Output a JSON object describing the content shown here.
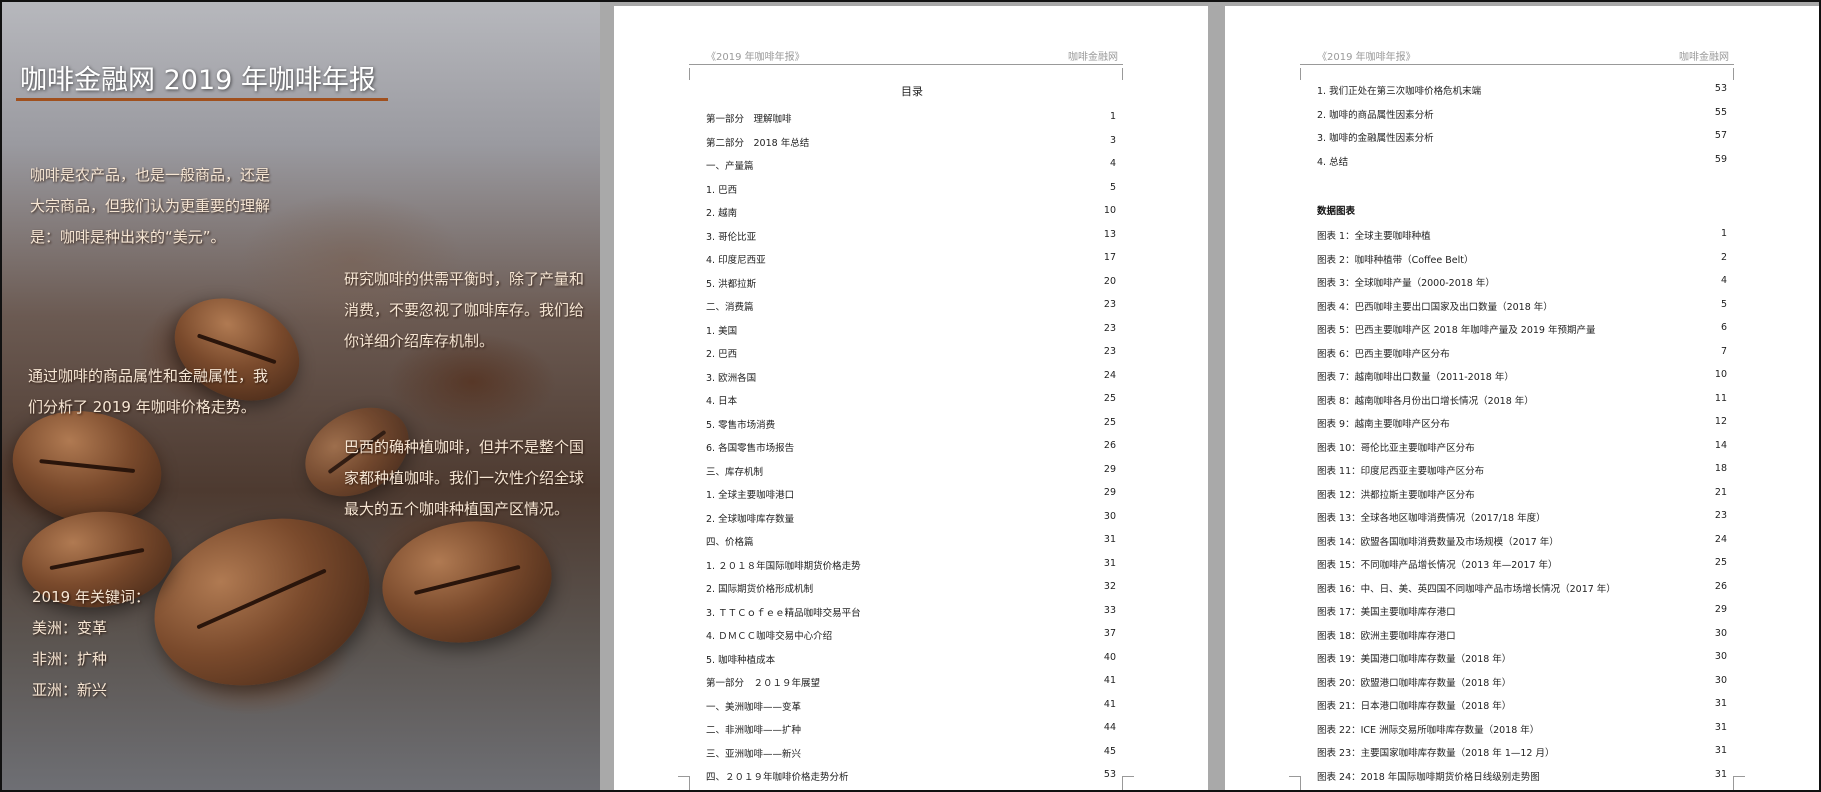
{
  "cover": {
    "title": "咖啡金融网 2019 年咖啡年报",
    "para1": "咖啡是农产品，也是一般商品，还是大宗商品，但我们认为更重要的理解是：咖啡是种出来的“美元”。",
    "para2": "研究咖啡的供需平衡时，除了产量和消费，不要忽视了咖啡库存。我们给你详细介绍库存机制。",
    "para3": "通过咖啡的商品属性和金融属性，我们分析了 2019 年咖啡价格走势。",
    "para4": "巴西的确种植咖啡，但并不是整个国家都种植咖啡。我们一次性介绍全球最大的五个咖啡种植国产区情况。",
    "keywords_title": "2019 年关键词：",
    "keywords": [
      "美洲：变革",
      "非洲：扩种",
      "亚洲：新兴"
    ]
  },
  "page1": {
    "header_left": "《2019 年咖啡年报》",
    "header_right": "咖啡金融网",
    "toc_title": "目录",
    "entries": [
      {
        "text": "第一部分　理解咖啡",
        "page": "1"
      },
      {
        "text": "第二部分　2018 年总结",
        "page": "3"
      },
      {
        "text": "一、产量篇",
        "page": "4"
      },
      {
        "text": "1. 巴西",
        "page": "5"
      },
      {
        "text": "2. 越南",
        "page": "10"
      },
      {
        "text": "3. 哥伦比亚",
        "page": "13"
      },
      {
        "text": "4. 印度尼西亚",
        "page": "17"
      },
      {
        "text": "5. 洪都拉斯",
        "page": "20"
      },
      {
        "text": "二、消费篇",
        "page": "23"
      },
      {
        "text": "1. 美国",
        "page": "23"
      },
      {
        "text": "2. 巴西",
        "page": "23"
      },
      {
        "text": "3. 欧洲各国",
        "page": "24"
      },
      {
        "text": "4. 日本",
        "page": "25"
      },
      {
        "text": "5. 零售市场消费",
        "page": "25"
      },
      {
        "text": "6. 各国零售市场报告",
        "page": "26"
      },
      {
        "text": "三、库存机制",
        "page": "29"
      },
      {
        "text": "1. 全球主要咖啡港口",
        "page": "29"
      },
      {
        "text": "2. 全球咖啡库存数量",
        "page": "30"
      },
      {
        "text": "四、价格篇",
        "page": "31"
      },
      {
        "text": "1. ２０１８年国际咖啡期货价格走势",
        "page": "31"
      },
      {
        "text": "2. 国际期货价格形成机制",
        "page": "32"
      },
      {
        "text": "3. ＴＴＣｏｆｅｅ精品咖啡交易平台",
        "page": "33"
      },
      {
        "text": "4. ＤＭＣＣ咖啡交易中心介绍",
        "page": "37"
      },
      {
        "text": "5. 咖啡种植成本",
        "page": "40"
      },
      {
        "text": "第一部分　２０１９年展望",
        "page": "41"
      },
      {
        "text": "一、美洲咖啡——变革",
        "page": "41"
      },
      {
        "text": "二、非洲咖啡——扩种",
        "page": "44"
      },
      {
        "text": "三、亚洲咖啡——新兴",
        "page": "45"
      },
      {
        "text": "四、２０１９年咖啡价格走势分析",
        "page": "53"
      }
    ]
  },
  "page2": {
    "header_left": "《2019 年咖啡年报》",
    "header_right": "咖啡金融网",
    "entries": [
      {
        "text": "1. 我们正处在第三次咖啡价格危机末端",
        "page": "53"
      },
      {
        "text": "2. 咖啡的商品属性因素分析",
        "page": "55"
      },
      {
        "text": "3. 咖啡的金融属性因素分析",
        "page": "57"
      },
      {
        "text": "4. 总结",
        "page": "59"
      }
    ],
    "section_title": "数据图表",
    "figures": [
      {
        "text": "图表 1：全球主要咖啡种植",
        "page": "1"
      },
      {
        "text": "图表 2：咖啡种植带（Coffee Belt）",
        "page": "2"
      },
      {
        "text": "图表 3：全球咖啡产量（2000-2018 年）",
        "page": "4"
      },
      {
        "text": "图表 4：巴西咖啡主要出口国家及出口数量（2018 年）",
        "page": "5"
      },
      {
        "text": "图表 5：巴西主要咖啡产区 2018 年咖啡产量及 2019 年预期产量",
        "page": "6"
      },
      {
        "text": "图表 6：巴西主要咖啡产区分布",
        "page": "7"
      },
      {
        "text": "图表 7：越南咖啡出口数量（2011-2018 年）",
        "page": "10"
      },
      {
        "text": "图表 8：越南咖啡各月份出口增长情况（2018 年）",
        "page": "11"
      },
      {
        "text": "图表 9：越南主要咖啡产区分布",
        "page": "12"
      },
      {
        "text": "图表 10：哥伦比亚主要咖啡产区分布",
        "page": "14"
      },
      {
        "text": "图表 11：印度尼西亚主要咖啡产区分布",
        "page": "18"
      },
      {
        "text": "图表 12：洪都拉斯主要咖啡产区分布",
        "page": "21"
      },
      {
        "text": "图表 13：全球各地区咖啡消费情况（2017/18 年度）",
        "page": "23"
      },
      {
        "text": "图表 14：欧盟各国咖啡消费数量及市场规模（2017 年）",
        "page": "24"
      },
      {
        "text": "图表 15：不同咖啡产品增长情况（2013 年—2017 年）",
        "page": "25"
      },
      {
        "text": "图表 16：中、日、美、英四国不同咖啡产品市场增长情况（2017 年）",
        "page": "26"
      },
      {
        "text": "图表 17：美国主要咖啡库存港口",
        "page": "29"
      },
      {
        "text": "图表 18：欧洲主要咖啡库存港口",
        "page": "30"
      },
      {
        "text": "图表 19：美国港口咖啡库存数量（2018 年）",
        "page": "30"
      },
      {
        "text": "图表 20：欧盟港口咖啡库存数量（2018 年）",
        "page": "30"
      },
      {
        "text": "图表 21：日本港口咖啡库存数量（2018 年）",
        "page": "31"
      },
      {
        "text": "图表 22：ICE 洲际交易所咖啡库存数量（2018 年）",
        "page": "31"
      },
      {
        "text": "图表 23：主要国家咖啡库存数量（2018 年 1—12 月）",
        "page": "31"
      },
      {
        "text": "图表 24：2018 年国际咖啡期货价格日线级别走势图",
        "page": "31"
      }
    ]
  }
}
